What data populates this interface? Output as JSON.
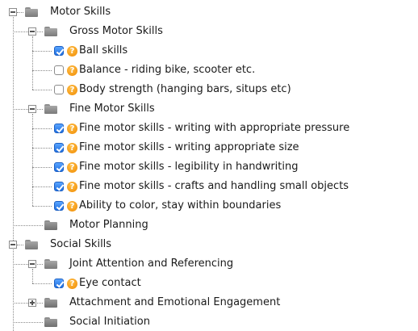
{
  "tree": [
    {
      "label": "Motor Skills",
      "level": 0,
      "kind": "folder",
      "toggle": "expanded",
      "checked": null
    },
    {
      "label": "Gross Motor Skills",
      "level": 1,
      "kind": "folder",
      "toggle": "expanded",
      "checked": null
    },
    {
      "label": "Ball skills",
      "level": 2,
      "kind": "item",
      "toggle": null,
      "checked": true
    },
    {
      "label": "Balance - riding bike, scooter etc.",
      "level": 2,
      "kind": "item",
      "toggle": null,
      "checked": false
    },
    {
      "label": "Body strength (hanging bars, situps etc)",
      "level": 2,
      "kind": "item",
      "toggle": null,
      "checked": false
    },
    {
      "label": "Fine Motor Skills",
      "level": 1,
      "kind": "folder",
      "toggle": "expanded",
      "checked": null
    },
    {
      "label": "Fine motor skills - writing with appropriate pressure",
      "level": 2,
      "kind": "item",
      "toggle": null,
      "checked": true
    },
    {
      "label": "Fine motor skills - writing appropriate size",
      "level": 2,
      "kind": "item",
      "toggle": null,
      "checked": true
    },
    {
      "label": "Fine motor skills - legibility in handwriting",
      "level": 2,
      "kind": "item",
      "toggle": null,
      "checked": true
    },
    {
      "label": "Fine motor skills - crafts and handling small objects",
      "level": 2,
      "kind": "item",
      "toggle": null,
      "checked": true
    },
    {
      "label": "Ability to color, stay within boundaries",
      "level": 2,
      "kind": "item",
      "toggle": null,
      "checked": true
    },
    {
      "label": "Motor Planning",
      "level": 1,
      "kind": "folder",
      "toggle": null,
      "checked": null
    },
    {
      "label": "Social Skills",
      "level": 0,
      "kind": "folder",
      "toggle": "expanded",
      "checked": null
    },
    {
      "label": "Joint Attention and Referencing",
      "level": 1,
      "kind": "folder",
      "toggle": "expanded",
      "checked": null
    },
    {
      "label": "Eye contact",
      "level": 2,
      "kind": "item",
      "toggle": null,
      "checked": true
    },
    {
      "label": "Attachment and Emotional Engagement",
      "level": 1,
      "kind": "folder",
      "toggle": "collapsed",
      "checked": null
    },
    {
      "label": "Social Initiation",
      "level": 1,
      "kind": "folder",
      "toggle": null,
      "checked": null
    }
  ],
  "icons": {
    "folder": "folder-icon",
    "help": "help-icon",
    "help_glyph": "?"
  },
  "colors": {
    "checkbox_checked": "#2f7fef",
    "help_badge": "#f59a12",
    "folder": "#888888",
    "tree_line": "#8a8a8a"
  }
}
